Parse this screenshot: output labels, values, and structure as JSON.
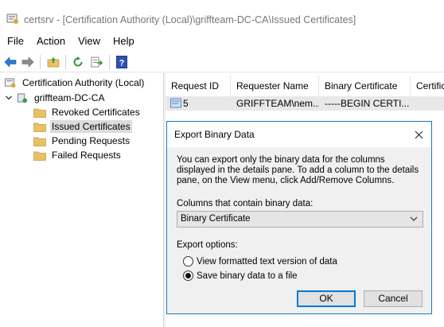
{
  "window": {
    "title": "certsrv - [Certification Authority (Local)\\griffteam-DC-CA\\Issued Certificates]"
  },
  "menu": {
    "items": [
      "File",
      "Action",
      "View",
      "Help"
    ]
  },
  "toolbar": {
    "icons": [
      "back-arrow-icon",
      "forward-arrow-icon",
      "up-folder-icon",
      "refresh-icon",
      "export-list-icon",
      "help-icon"
    ]
  },
  "tree": {
    "root": "Certification Authority (Local)",
    "ca": "griffteam-DC-CA",
    "folders": [
      "Revoked Certificates",
      "Issued Certificates",
      "Pending Requests",
      "Failed Requests"
    ],
    "selected": "Issued Certificates"
  },
  "list": {
    "columns": [
      "Request ID",
      "Requester Name",
      "Binary Certificate",
      "Certific"
    ],
    "rows": [
      {
        "request_id": "5",
        "requester": "GRIFFTEAM\\nem...",
        "binary": "-----BEGIN CERTI...",
        "certific": ""
      }
    ]
  },
  "dialog": {
    "title": "Export Binary Data",
    "description": "You can export only the binary data for the columns displayed in the details pane. To add a column to the details pane, on the View menu, click Add/Remove Columns.",
    "columns_label": "Columns that contain binary data:",
    "columns_selected": "Binary Certificate",
    "options_label": "Export options:",
    "options": [
      {
        "label": "View formatted text version of data",
        "checked": false
      },
      {
        "label": "Save binary data to a file",
        "checked": true
      }
    ],
    "ok_label": "OK",
    "cancel_label": "Cancel"
  },
  "colors": {
    "accent": "#0078d7",
    "dialog_border": "#1979ca",
    "selection": "#dcdcdc",
    "folder": "#e8c163"
  }
}
